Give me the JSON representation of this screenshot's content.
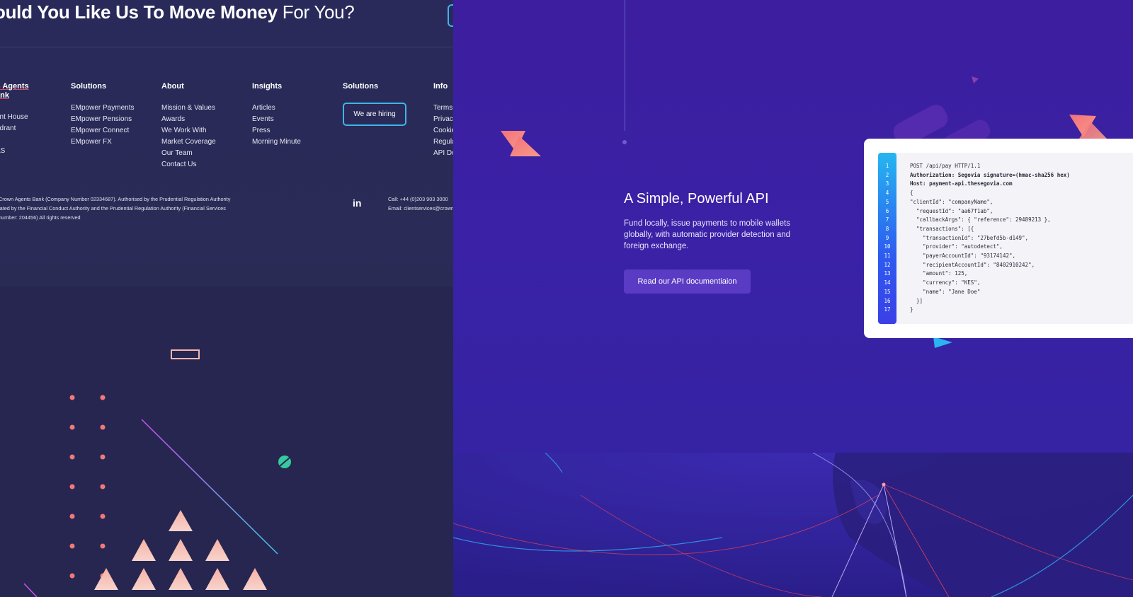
{
  "left": {
    "headline_bold": "ould You Like Us To Move Money",
    "headline_light": "For You?",
    "columns": [
      {
        "title": "n Agents\nank",
        "items": [
          "ant House",
          "adrant",
          "",
          "AS"
        ]
      },
      {
        "title": "Solutions",
        "items": [
          "EMpower Payments",
          "EMpower Pensions",
          "EMpower Connect",
          "EMpower FX"
        ]
      },
      {
        "title": "About",
        "items": [
          "Mission & Values",
          "Awards",
          "We Work With",
          "Market Coverage",
          "Our Team",
          "Contact Us"
        ]
      },
      {
        "title": "Insights",
        "items": [
          "Articles",
          "Events",
          "Press",
          "Morning Minute"
        ]
      },
      {
        "title": "Solutions",
        "hiring_button": "We are hiring"
      },
      {
        "title": "Info",
        "items": [
          "Terms",
          "Privacy",
          "Cookie",
          "Regula",
          "API Do"
        ]
      }
    ],
    "legal": [
      "Crown Agents Bank (Company Number 02334687).  Authorised by the Prudential Regulation Authority",
      "lated by the Financial Conduct Authority and the Prudential Regulation Authority (Financial Services",
      "number: 204456) All rights reserved"
    ],
    "linkedin": "in",
    "contact": [
      "Call: +44 (0)203 903 3000",
      "Email: clientservices@crown"
    ]
  },
  "right": {
    "api_title": "A Simple, Powerful API",
    "api_desc": "Fund locally, issue payments to mobile wallets globally, with automatic provider detection and foreign exchange.",
    "api_button": "Read our API documentiaion",
    "line_numbers": [
      "1",
      "2",
      "3",
      "4",
      "5",
      "6",
      "7",
      "8",
      "9",
      "10",
      "11",
      "12",
      "13",
      "14",
      "15",
      "16",
      "17"
    ],
    "code_lines": [
      "POST /api/pay HTTP/1.1",
      "Authorization: Segovia signature=(hmac-sha256 hex)",
      "Host: payment-api.thesegovia.com",
      "{",
      "\"clientId\": \"companyName\",",
      "  \"requestId\": \"aa67f1ab\",",
      "  \"callbackArgs\": { \"reference\": 29489213 },",
      "  \"transactions\": [{",
      "    \"transactionId\": \"27befd5b-d149\",",
      "    \"provider\": \"autodetect\",",
      "    \"payerAccountId\": \"93174142\",",
      "    \"recipientAccountId\": \"8402910242\",",
      "    \"amount\": 125,",
      "    \"currency\": \"KES\",",
      "    \"name\": \"Jane Doe\"",
      "  }]",
      "}"
    ]
  },
  "colors": {
    "left_bg": "#262650",
    "right_bg": "#3a21a6",
    "accent_blue": "#3fb4e6",
    "accent_purple": "#5a3cc4",
    "coral": "#f4707a"
  }
}
